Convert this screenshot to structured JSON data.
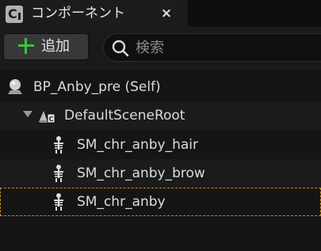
{
  "tab": {
    "title": "コンポーネント",
    "close_glyph": "×",
    "icon": "blueprint-c-icon"
  },
  "toolbar": {
    "add_label": "追加",
    "add_icon": "plus-icon",
    "search_placeholder": "検索",
    "search_value": ""
  },
  "tree": {
    "root": {
      "label": "BP_Anby_pre (Self)",
      "icon": "actor-self-icon"
    },
    "scene_root": {
      "label": "DefaultSceneRoot",
      "icon": "scene-root-icon",
      "expanded": true
    },
    "children": [
      {
        "label": "SM_chr_anby_hair",
        "icon": "skeletal-mesh-icon"
      },
      {
        "label": "SM_chr_anby_brow",
        "icon": "skeletal-mesh-icon"
      },
      {
        "label": "SM_chr_anby",
        "icon": "skeletal-mesh-icon",
        "selected": true
      }
    ]
  },
  "colors": {
    "accent_green": "#3cc23c",
    "selection_outline": "#c98b1d",
    "background": "#151515"
  }
}
